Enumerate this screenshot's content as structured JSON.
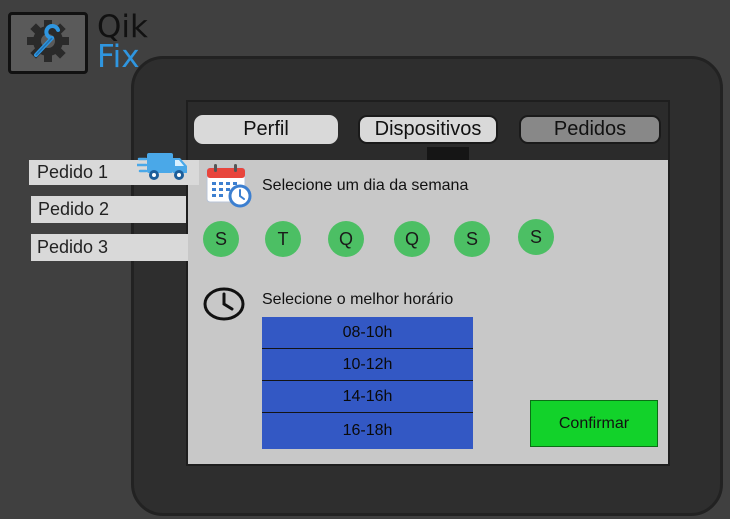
{
  "app": {
    "name_line1": "Qik",
    "name_line2": "Fix",
    "brand_color": "#2f96e0",
    "logo_icon": "wrench-gear-icon"
  },
  "tabs": [
    {
      "label": "Perfil"
    },
    {
      "label": "Dispositivos"
    },
    {
      "label": "Pedidos",
      "active": true
    }
  ],
  "orders": [
    {
      "label": "Pedido 1",
      "icon": "delivery-truck-icon"
    },
    {
      "label": "Pedido 2"
    },
    {
      "label": "Pedido 3"
    }
  ],
  "day_section": {
    "label": "Selecione um dia da semana",
    "icon": "calendar-icon",
    "days": [
      "S",
      "T",
      "Q",
      "Q",
      "S",
      "S"
    ],
    "day_color": "#4cbf64"
  },
  "time_section": {
    "label": "Selecione o melhor horário",
    "icon": "clock-icon",
    "slots": [
      "08-10h",
      "10-12h",
      "14-16h",
      "16-18h"
    ],
    "slot_color": "#3358c4"
  },
  "confirm": {
    "label": "Confirmar",
    "color": "#12d22a"
  }
}
